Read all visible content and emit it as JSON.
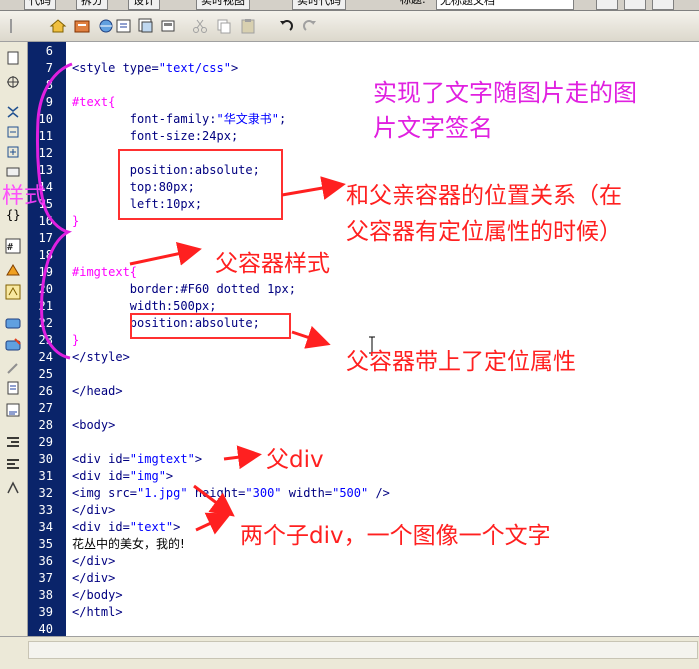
{
  "menubar": {
    "code_view": "代码",
    "split_view": "拆分",
    "design_view": "设计",
    "live_view": "实时视图",
    "live_code": "实时代码",
    "title_label": "标题:",
    "title_value": "无标题文档"
  },
  "toolbar": {
    "icons": [
      "home-icon",
      "file-management-icon",
      "preview-browser-icon",
      "refresh-icon",
      "view-options-icon",
      "visual-aids-icon",
      "cut-icon",
      "copy-icon",
      "paste-icon",
      "undo-icon",
      "redo-icon"
    ]
  },
  "sidebar": {
    "icons": [
      "open-documents-icon",
      "show-code-navigator-icon",
      "collapse-full-tag-icon",
      "collapse-selection-icon",
      "expand-all-icon",
      "select-parent-tag-icon",
      "balance-braces-icon",
      "line-numbers-icon",
      "highlight-invalid-code-icon",
      "syntax-error-icon",
      "apply-comment-icon",
      "remove-comment-icon",
      "wrap-tag-icon",
      "recent-snippets-icon",
      "move-css-icon",
      "indent-icon",
      "outdent-icon",
      "format-source-icon"
    ]
  },
  "editor": {
    "line_numbers": [
      "6",
      "7",
      "8",
      "9",
      "10",
      "11",
      "12",
      "13",
      "14",
      "15",
      "16",
      "17",
      "18",
      "19",
      "20",
      "21",
      "22",
      "23",
      "24",
      "25",
      "26",
      "27",
      "28",
      "29",
      "30",
      "31",
      "32",
      "33",
      "34",
      "35",
      "36",
      "37",
      "38",
      "39",
      "40"
    ],
    "lines": {
      "l7_tag": "<style type=",
      "l7_str": "\"text/css\"",
      "l7_end": ">",
      "l9": "#text{",
      "l10_prop": "        font-family:",
      "l10_str": "\"华文隶书\"",
      "l10_end": ";",
      "l11": "        font-size:24px;",
      "l13": "        position:absolute;",
      "l14": "        top:80px;",
      "l15": "        left:10px;",
      "l16": "}",
      "l19": "#imgtext{",
      "l20": "        border:#F60 dotted 1px;",
      "l21": "        width:500px;",
      "l22": "        position:absolute;",
      "l23": "}",
      "l24": "</style>",
      "l26": "</head>",
      "l28": "<body>",
      "l30_tag": "<div id=",
      "l30_str": "\"imgtext\"",
      "l30_end": ">",
      "l31_tag": "<div id=",
      "l31_str": "\"img\"",
      "l31_end": ">",
      "l32_tag": "<img src=",
      "l32_str": "\"1.jpg\"",
      "l32_mid": " height=",
      "l32_str2": "\"300\"",
      "l32_mid2": " width=",
      "l32_str3": "\"500\"",
      "l32_end": " />",
      "l33": "</div>",
      "l34_tag": "<div id=",
      "l34_str": "\"text\"",
      "l34_end": ">",
      "l35": "花丛中的美女，我的!",
      "l36": "</div>",
      "l37": "</div>",
      "l38": "</body>",
      "l39": "</html>"
    }
  },
  "annotations": {
    "title_note_1": "实现了文字随图片走的图",
    "title_note_2": "片文字签名",
    "style_label": "样式",
    "relation_note_1": "和父亲容器的位置关系（在",
    "relation_note_2": "父容器有定位属性的时候）",
    "parent_style": "父容器样式",
    "parent_position": "父容器带上了定位属性",
    "parent_div": "父div",
    "child_divs": "两个子div，一个图像一个文字"
  },
  "colors": {
    "annotation_red": "#ff2020",
    "annotation_magenta": "#e020e0",
    "gutter_blue": "#0a246a",
    "selector_magenta": "#ff00ff",
    "string_blue": "#0000ff",
    "tag_navy": "#000080"
  }
}
